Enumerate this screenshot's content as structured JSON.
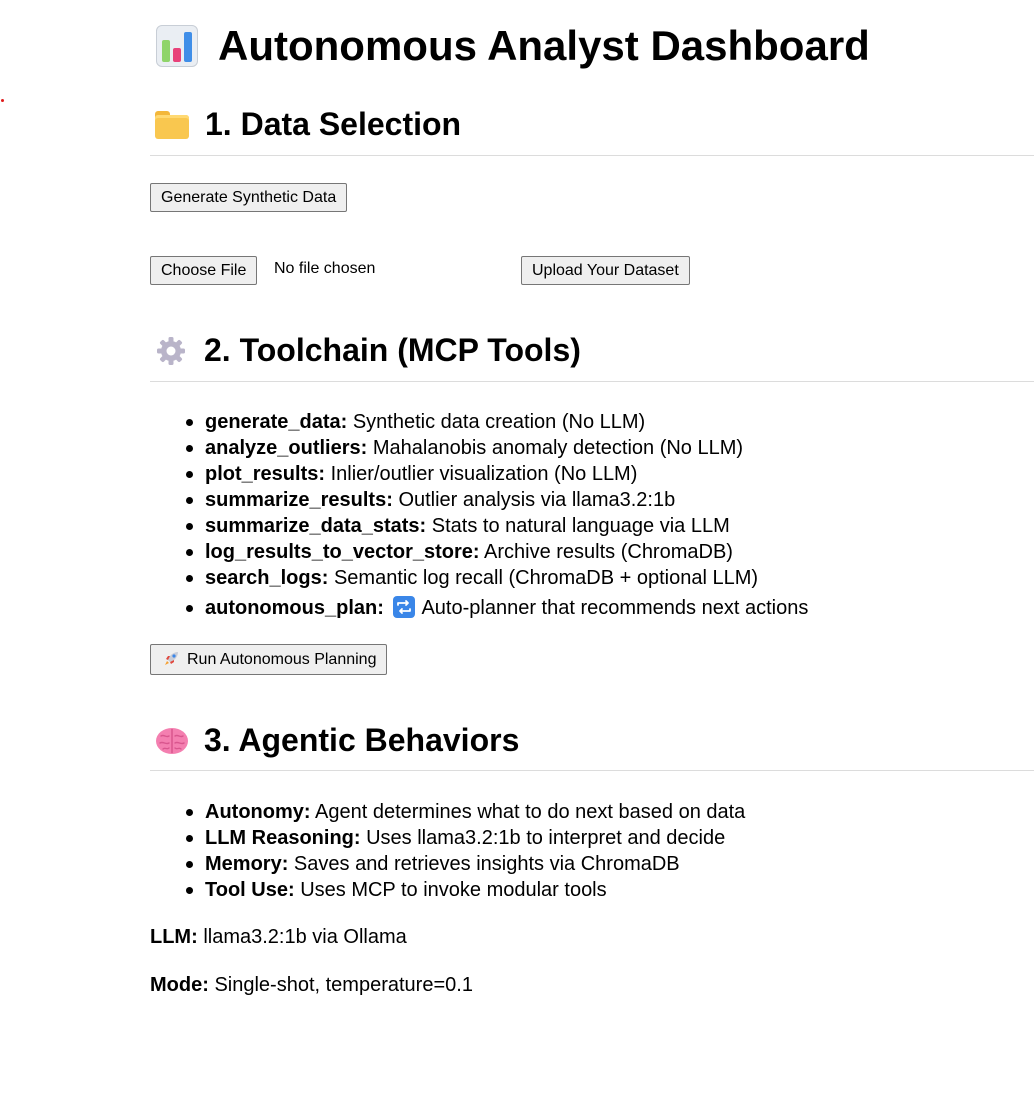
{
  "title": "Autonomous Analyst Dashboard",
  "sections": {
    "data_selection": {
      "heading": "1. Data Selection",
      "generate_button": "Generate Synthetic Data",
      "choose_file_button": "Choose File",
      "file_status": "No file chosen",
      "upload_button": "Upload Your Dataset"
    },
    "toolchain": {
      "heading": "2. Toolchain (MCP Tools)",
      "tools": [
        {
          "name": "generate_data:",
          "desc": "Synthetic data creation (No LLM)"
        },
        {
          "name": "analyze_outliers:",
          "desc": "Mahalanobis anomaly detection (No LLM)"
        },
        {
          "name": "plot_results:",
          "desc": "Inlier/outlier visualization (No LLM)"
        },
        {
          "name": "summarize_results:",
          "desc": "Outlier analysis via llama3.2:1b"
        },
        {
          "name": "summarize_data_stats:",
          "desc": "Stats to natural language via LLM"
        },
        {
          "name": "log_results_to_vector_store:",
          "desc": "Archive results (ChromaDB)"
        },
        {
          "name": "search_logs:",
          "desc": "Semantic log recall (ChromaDB + optional LLM)"
        },
        {
          "name": "autonomous_plan:",
          "desc": "Auto-planner that recommends next actions"
        }
      ],
      "run_button": "Run Autonomous Planning"
    },
    "behaviors": {
      "heading": "3. Agentic Behaviors",
      "items": [
        {
          "name": "Autonomy:",
          "desc": "Agent determines what to do next based on data"
        },
        {
          "name": "LLM Reasoning:",
          "desc": "Uses llama3.2:1b to interpret and decide"
        },
        {
          "name": "Memory:",
          "desc": "Saves and retrieves insights via ChromaDB"
        },
        {
          "name": "Tool Use:",
          "desc": "Uses MCP to invoke modular tools"
        }
      ]
    }
  },
  "footer": {
    "llm_label": "LLM:",
    "llm_value": "llama3.2:1b via Ollama",
    "mode_label": "Mode:",
    "mode_value": "Single-shot, temperature=0.1"
  },
  "icons": {
    "title": "bar-chart-icon",
    "data_selection": "folder-icon",
    "toolchain": "gear-icon",
    "behaviors": "brain-icon",
    "autonomous_plan": "repeat-icon",
    "run_button": "rocket-icon"
  },
  "colors": {
    "folder": "#f9c74f",
    "gear": "#b9b4c9",
    "brain": "#f47fb0",
    "repeat": "#3a86e8",
    "button_bg": "#efefef",
    "button_border": "#767676"
  }
}
